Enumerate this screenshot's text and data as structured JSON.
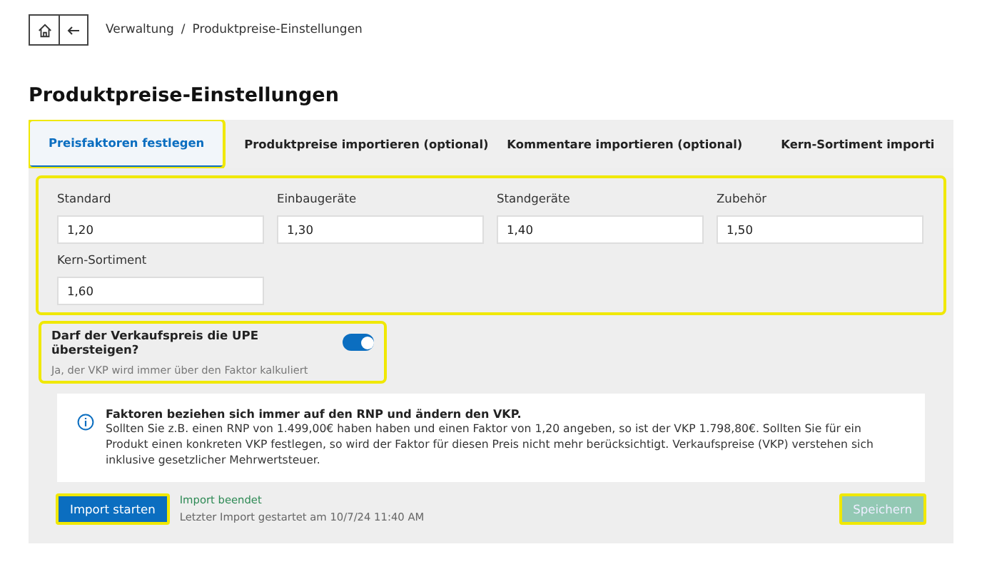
{
  "breadcrumb": {
    "items": [
      "Verwaltung",
      "Produktpreise-Einstellungen"
    ],
    "separator": "/"
  },
  "title": "Produktpreise-Einstellungen",
  "tabs": [
    {
      "label": "Preisfaktoren festlegen",
      "selected": true,
      "highlighted": true
    },
    {
      "label": "Produktpreise importieren (optional)",
      "selected": false,
      "highlighted": false
    },
    {
      "label": "Kommentare importieren (optional)",
      "selected": false,
      "highlighted": false
    },
    {
      "label": "Kern-Sortiment importi",
      "selected": false,
      "highlighted": false
    }
  ],
  "factors": {
    "highlighted": true,
    "fields": [
      {
        "label": "Standard",
        "value": "1,20"
      },
      {
        "label": "Einbaugeräte",
        "value": "1,30"
      },
      {
        "label": "Standgeräte",
        "value": "1,40"
      },
      {
        "label": "Zubehör",
        "value": "1,50"
      },
      {
        "label": "Kern-Sortiment",
        "value": "1,60"
      }
    ]
  },
  "toggle": {
    "label": "Darf der Verkaufspreis die UPE übersteigen?",
    "on": true,
    "hint": "Ja, der VKP wird immer über den Faktor kalkuliert",
    "highlighted": true
  },
  "info": {
    "heading": "Faktoren beziehen sich immer auf den RNP und ändern den VKP.",
    "text": "Sollten Sie z.B. einen RNP von 1.499,00€ haben haben und einen Faktor von 1,20 angeben, so ist der VKP 1.798,80€. Sollten Sie für ein Produkt einen konkreten VKP festlegen, so wird der Faktor für diesen Preis nicht mehr berücksichtigt. Verkaufspreise (VKP) verstehen sich inklusive gesetzlicher Mehrwertsteuer."
  },
  "import": {
    "button": "Import starten",
    "highlighted": true,
    "status": "Import beendet",
    "last": "Letzter Import gestartet am 10/7/24 11:40 AM"
  },
  "save": {
    "label": "Speichern",
    "disabled": true,
    "highlighted": true
  }
}
